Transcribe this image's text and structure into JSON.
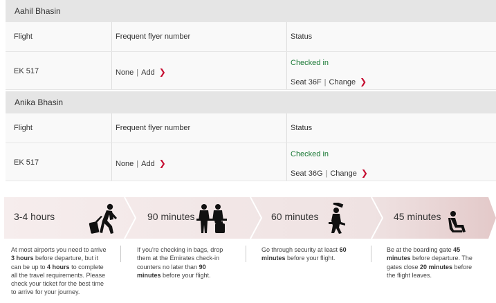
{
  "passengers": [
    {
      "name": "Aahil Bhasin",
      "headers": {
        "flight": "Flight",
        "ffn": "Frequent flyer number",
        "status": "Status"
      },
      "flight": "EK 517",
      "ffn_value": "None",
      "ffn_action": "Add",
      "status": "Checked in",
      "seat_label": "Seat",
      "seat": "36F",
      "seat_action": "Change"
    },
    {
      "name": "Anika Bhasin",
      "headers": {
        "flight": "Flight",
        "ffn": "Frequent flyer number",
        "status": "Status"
      },
      "flight": "EK 517",
      "ffn_value": "None",
      "ffn_action": "Add",
      "status": "Checked in",
      "seat_label": "Seat",
      "seat": "36G",
      "seat_action": "Change"
    }
  ],
  "timeline": [
    {
      "label": "3-4 hours",
      "icon": "traveller-with-luggage-icon",
      "parts": [
        "At most airports you need to arrive ",
        "3 hours",
        " before departure, but it can be up to ",
        "4 hours",
        " to complete all the travel requirements. Please check your ticket for the best time to arrive for your journey."
      ]
    },
    {
      "label": "90 minutes",
      "icon": "check-in-counter-icon",
      "parts": [
        "If you're checking in bags, drop them at the Emirates check-in counters no later than ",
        "90 minutes",
        " before your flight."
      ]
    },
    {
      "label": "60 minutes",
      "icon": "security-check-icon",
      "parts": [
        "Go through security at least ",
        "60 minutes",
        " before your flight."
      ]
    },
    {
      "label": "45 minutes",
      "icon": "boarding-gate-seat-icon",
      "parts": [
        "Be at the boarding gate ",
        "45 minutes",
        " before departure. The gates close ",
        "20 minutes",
        " before the flight leaves."
      ]
    }
  ],
  "colors": {
    "checked_in": "#1c7a37",
    "chevron": "#c60c30",
    "timeline_band": "#f3e6e6"
  }
}
